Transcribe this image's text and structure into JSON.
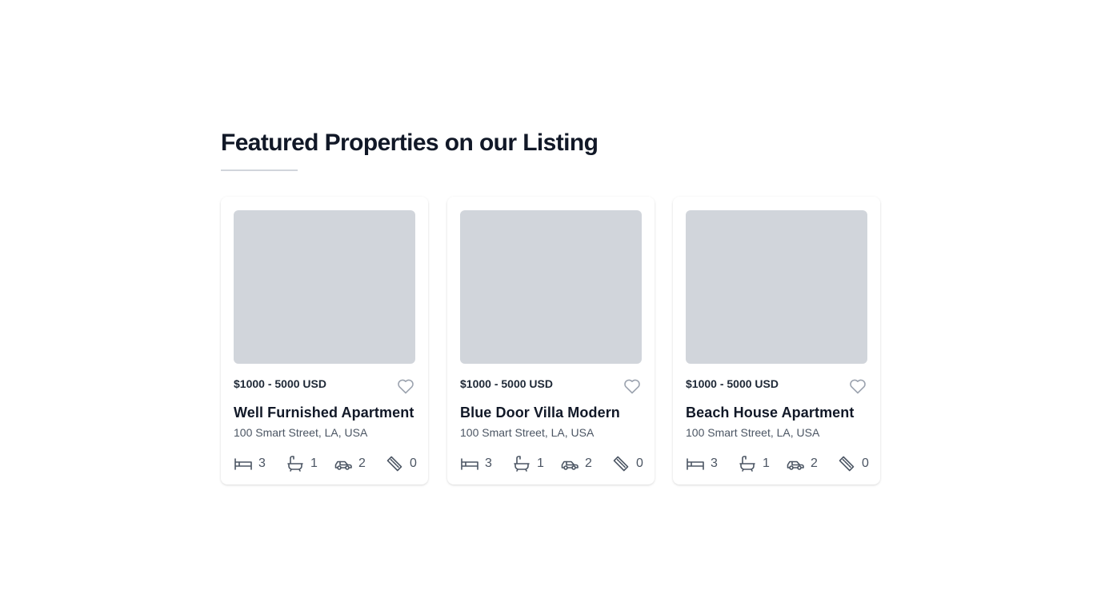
{
  "section": {
    "title": "Featured Properties on our Listing"
  },
  "listings": [
    {
      "price": "$1000 - 5000 USD",
      "title": "Well Furnished Apartment",
      "address": "100 Smart Street, LA, USA",
      "beds": "3",
      "baths": "1",
      "parking": "2",
      "area": "0"
    },
    {
      "price": "$1000 - 5000 USD",
      "title": "Blue Door Villa Modern",
      "address": "100 Smart Street, LA, USA",
      "beds": "3",
      "baths": "1",
      "parking": "2",
      "area": "0"
    },
    {
      "price": "$1000 - 5000 USD",
      "title": "Beach House Apartment",
      "address": "100 Smart Street, LA, USA",
      "beds": "3",
      "baths": "1",
      "parking": "2",
      "area": "0"
    }
  ],
  "icons": {
    "favorite": "heart-icon",
    "beds": "bed-icon",
    "baths": "bathtub-icon",
    "parking": "car-icon",
    "area": "ruler-icon"
  },
  "colors": {
    "image_placeholder": "#d1d5db",
    "icon": "#4b5563",
    "heart": "#9ca3af",
    "title": "#111827"
  }
}
